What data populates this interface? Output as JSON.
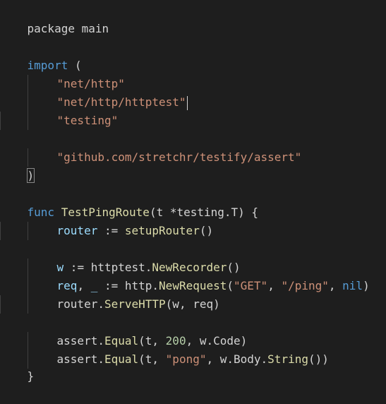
{
  "editor": {
    "lines": [
      {
        "tokens": [
          {
            "t": "package main"
          }
        ]
      },
      {
        "tokens": []
      },
      {
        "tokens": [
          {
            "t": "import"
          },
          {
            "t": " "
          },
          {
            "t": "("
          }
        ]
      },
      {
        "tokens": [
          {
            "t": "\"net/http\""
          }
        ]
      },
      {
        "tokens": [
          {
            "t": "\"net/http/httptest\""
          }
        ]
      },
      {
        "tokens": [
          {
            "t": "\"testing\""
          }
        ]
      },
      {
        "tokens": []
      },
      {
        "tokens": [
          {
            "t": "\"github.com/stretchr/testify/assert\""
          }
        ]
      },
      {
        "tokens": [
          {
            "t": ")"
          }
        ]
      },
      {
        "tokens": []
      },
      {
        "tokens": [
          {
            "t": "func"
          },
          {
            "t": " "
          },
          {
            "t": "TestPingRoute"
          },
          {
            "t": "(t *testing.T) {"
          }
        ]
      },
      {
        "tokens": [
          {
            "t": "router"
          },
          {
            "t": " := "
          },
          {
            "t": "setupRouter"
          },
          {
            "t": "()"
          }
        ]
      },
      {
        "tokens": []
      },
      {
        "tokens": [
          {
            "t": "w"
          },
          {
            "t": " := httptest."
          },
          {
            "t": "NewRecorder"
          },
          {
            "t": "()"
          }
        ]
      },
      {
        "tokens": [
          {
            "t": "req"
          },
          {
            "t": ", "
          },
          {
            "t": "_"
          },
          {
            "t": " := http."
          },
          {
            "t": "NewRequest"
          },
          {
            "t": "("
          },
          {
            "t": "\"GET\""
          },
          {
            "t": ", "
          },
          {
            "t": "\"/ping\""
          },
          {
            "t": ", "
          },
          {
            "t": "nil"
          },
          {
            "t": ")"
          }
        ]
      },
      {
        "tokens": [
          {
            "t": "router."
          },
          {
            "t": "ServeHTTP"
          },
          {
            "t": "(w, req)"
          }
        ]
      },
      {
        "tokens": []
      },
      {
        "tokens": [
          {
            "t": "assert."
          },
          {
            "t": "Equal"
          },
          {
            "t": "(t, "
          },
          {
            "t": "200"
          },
          {
            "t": ", w.Code)"
          }
        ]
      },
      {
        "tokens": [
          {
            "t": "assert."
          },
          {
            "t": "Equal"
          },
          {
            "t": "(t, "
          },
          {
            "t": "\"pong\""
          },
          {
            "t": ", w.Body."
          },
          {
            "t": "String"
          },
          {
            "t": "())"
          }
        ]
      },
      {
        "tokens": [
          {
            "t": "}"
          }
        ]
      }
    ]
  },
  "theme": {
    "background": "#1e1e1e",
    "keyword": "#569cd6",
    "string": "#ce9178",
    "function": "#dcdcaa",
    "variable": "#9cdcfe",
    "number": "#b5cea8",
    "plain": "#d4d4d4"
  }
}
